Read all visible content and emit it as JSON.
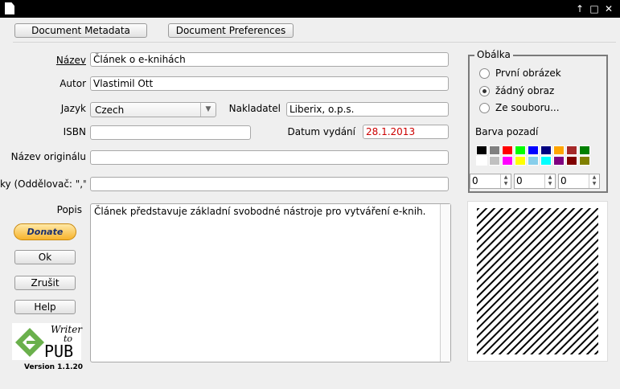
{
  "toolbar": {
    "metadata_label": "Document Metadata",
    "preferences_label": "Document Preferences"
  },
  "form": {
    "nazev_label": "Název",
    "nazev_value": "Článek o e-knihách",
    "autor_label": "Autor",
    "autor_value": "Vlastimil Ott",
    "jazyk_label": "Jazyk",
    "jazyk_value": "Czech",
    "nakladatel_label": "Nakladatel",
    "nakladatel_value": "Liberix, o.p.s.",
    "isbn_label": "ISBN",
    "isbn_value": "",
    "datum_label": "Datum vydání",
    "datum_value": "28.1.2013",
    "nazev_originalu_label": "Název originálu",
    "nazev_originalu_value": "",
    "klicova_slova_label": "ky (Oddělovač: \",\")",
    "klicova_slova_value": "",
    "popis_label": "Popis",
    "popis_value": "Článek představuje základní svobodné nástroje pro vytváření e-knih."
  },
  "cover": {
    "title": "Obálka",
    "options": [
      "První obrázek",
      "žádný obraz",
      "Ze souboru..."
    ],
    "selected": "žádný obraz",
    "bg_label": "Barva pozadí",
    "colors": [
      "#000000",
      "#808080",
      "#ff0000",
      "#00ff00",
      "#0000ff",
      "#000080",
      "#ffa500",
      "#a52a2a",
      "#008000",
      "#ffffff",
      "#c0c0c0",
      "#ff00ff",
      "#ffff00",
      "#87ceeb",
      "#00ffff",
      "#800080",
      "#800000",
      "#808000"
    ],
    "rgb_values": [
      "0",
      "0",
      "0"
    ]
  },
  "buttons": {
    "donate_label": "Donate",
    "ok_label": "Ok",
    "cancel_label": "Zrušit",
    "help_label": "Help"
  },
  "logo": {
    "line1": "Writer",
    "line2": "to",
    "line3": "PUB"
  },
  "version": "Version 1.1.20",
  "colors": {
    "date_text": "#cc0000",
    "frame_border": "#7a7a7a"
  }
}
